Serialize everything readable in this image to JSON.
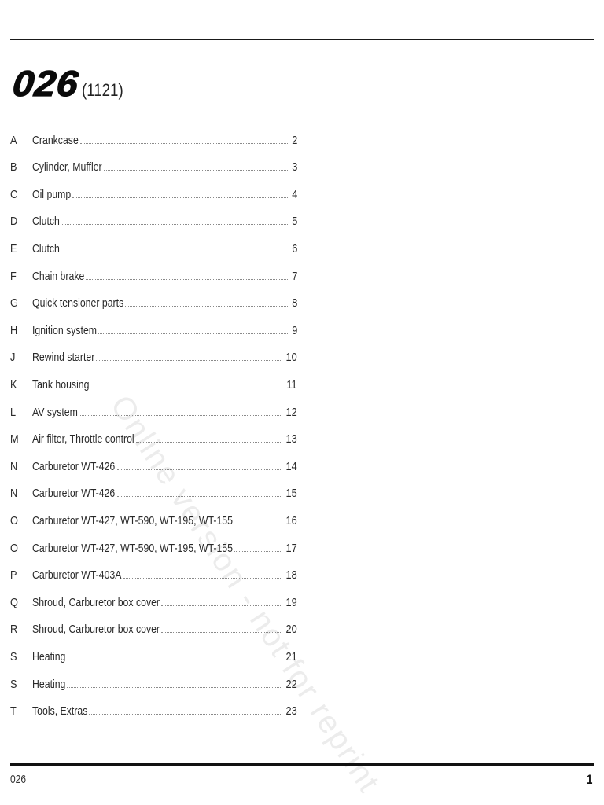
{
  "header": {
    "model": "026",
    "code": "(1121)"
  },
  "toc": [
    {
      "letter": "A",
      "title": "Crankcase",
      "page": "2"
    },
    {
      "letter": "B",
      "title": "Cylinder, Muffler",
      "page": "3"
    },
    {
      "letter": "C",
      "title": "Oil pump",
      "page": "4"
    },
    {
      "letter": "D",
      "title": "Clutch",
      "page": "5"
    },
    {
      "letter": "E",
      "title": "Clutch",
      "page": "6"
    },
    {
      "letter": "F",
      "title": "Chain brake",
      "page": "7"
    },
    {
      "letter": "G",
      "title": "Quick tensioner parts",
      "page": "8"
    },
    {
      "letter": "H",
      "title": "Ignition system",
      "page": "9"
    },
    {
      "letter": "J",
      "title": "Rewind starter",
      "page": "10"
    },
    {
      "letter": "K",
      "title": "Tank housing",
      "page": "11"
    },
    {
      "letter": "L",
      "title": "AV system",
      "page": "12"
    },
    {
      "letter": "M",
      "title": "Air filter, Throttle control",
      "page": "13"
    },
    {
      "letter": "N",
      "title": "Carburetor WT-426",
      "page": "14"
    },
    {
      "letter": "N",
      "title": "Carburetor WT-426",
      "page": "15"
    },
    {
      "letter": "O",
      "title": "Carburetor WT-427, WT-590, WT-195, WT-155",
      "page": "16"
    },
    {
      "letter": "O",
      "title": "Carburetor WT-427, WT-590, WT-195, WT-155",
      "page": "17"
    },
    {
      "letter": "P",
      "title": "Carburetor WT-403A",
      "page": "18"
    },
    {
      "letter": "Q",
      "title": "Shroud, Carburetor box cover",
      "page": "19"
    },
    {
      "letter": "R",
      "title": "Shroud, Carburetor box cover",
      "page": "20"
    },
    {
      "letter": "S",
      "title": "Heating",
      "page": "21"
    },
    {
      "letter": "S",
      "title": "Heating",
      "page": "22"
    },
    {
      "letter": "T",
      "title": "Tools, Extras",
      "page": "23"
    }
  ],
  "watermark": "Online version - not for reprint",
  "footer": {
    "model": "026",
    "page_number": "1"
  }
}
